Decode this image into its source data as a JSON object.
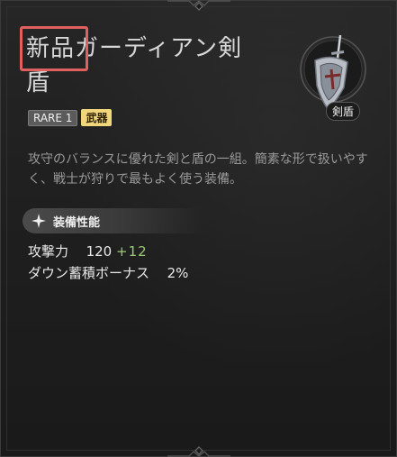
{
  "item": {
    "title": "新品ガーディアン剣盾",
    "rarity_label": "RARE 1",
    "category_label": "武器",
    "type_label": "剣盾",
    "description": "攻守のバランスに優れた剣と盾の一組。簡素な形で扱いやすく、戦士が狩りで最もよく使う装備。"
  },
  "section": {
    "title": "装備性能"
  },
  "stats": [
    {
      "name": "攻撃力",
      "value": "120",
      "bonus": "+12"
    },
    {
      "name": "ダウン蓄積ボーナス",
      "value": "2%"
    }
  ],
  "colors": {
    "highlight": "#e06060",
    "bonus": "#9acb73",
    "weapon_badge": "#f1d77a"
  },
  "icons": {
    "emblem": "sword-shield-icon",
    "section": "sparkle-icon"
  }
}
